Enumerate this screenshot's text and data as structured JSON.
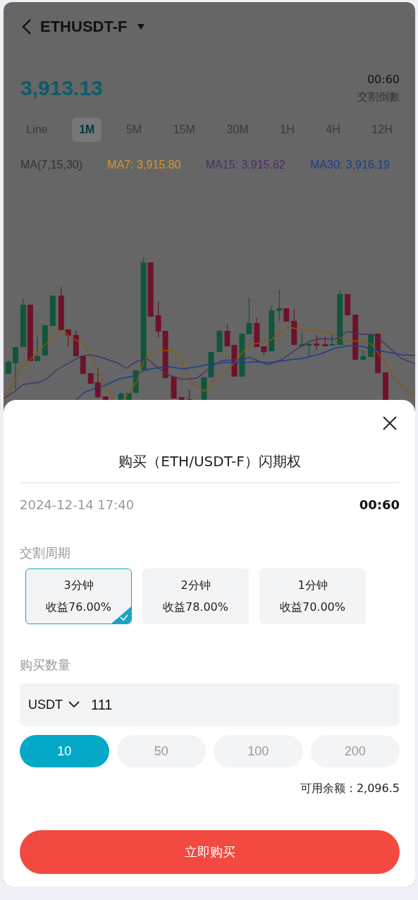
{
  "header": {
    "symbol": "ETHUSDT-F"
  },
  "price": "3,913.13",
  "countdown": {
    "time": "00:60",
    "label": "交割倒數"
  },
  "timeframes": [
    {
      "label": "Line",
      "selected": false
    },
    {
      "label": "1M",
      "selected": true
    },
    {
      "label": "5M",
      "selected": false
    },
    {
      "label": "15M",
      "selected": false
    },
    {
      "label": "30M",
      "selected": false
    },
    {
      "label": "1H",
      "selected": false
    },
    {
      "label": "4H",
      "selected": false
    },
    {
      "label": "12H",
      "selected": false
    }
  ],
  "indicators": {
    "label": "MA(7,15,30)",
    "values": [
      {
        "text": "MA7: 3,915.80",
        "color": "#d8962a"
      },
      {
        "text": "MA15: 3,915.62",
        "color": "#4a2f6a"
      },
      {
        "text": "MA30: 3,916.19",
        "color": "#1a3f8a"
      }
    ]
  },
  "sheet": {
    "title": "购买（ETH/USDT-F）闪期权",
    "date": "2024-12-14 17:40",
    "time": "00:60",
    "period_label": "交割周期",
    "periods": [
      {
        "duration": "3分钟",
        "yield": "收益76.00%",
        "selected": true
      },
      {
        "duration": "2分钟",
        "yield": "收益78.00%",
        "selected": false
      },
      {
        "duration": "1分钟",
        "yield": "收益70.00%",
        "selected": false
      }
    ],
    "amount_label": "购买数量",
    "currency": "USDT",
    "amount": "111",
    "presets": [
      {
        "label": "10",
        "selected": true
      },
      {
        "label": "50",
        "selected": false
      },
      {
        "label": "100",
        "selected": false
      },
      {
        "label": "200",
        "selected": false
      }
    ],
    "balance": "可用余额：2,096.5",
    "submit": "立即购买"
  }
}
